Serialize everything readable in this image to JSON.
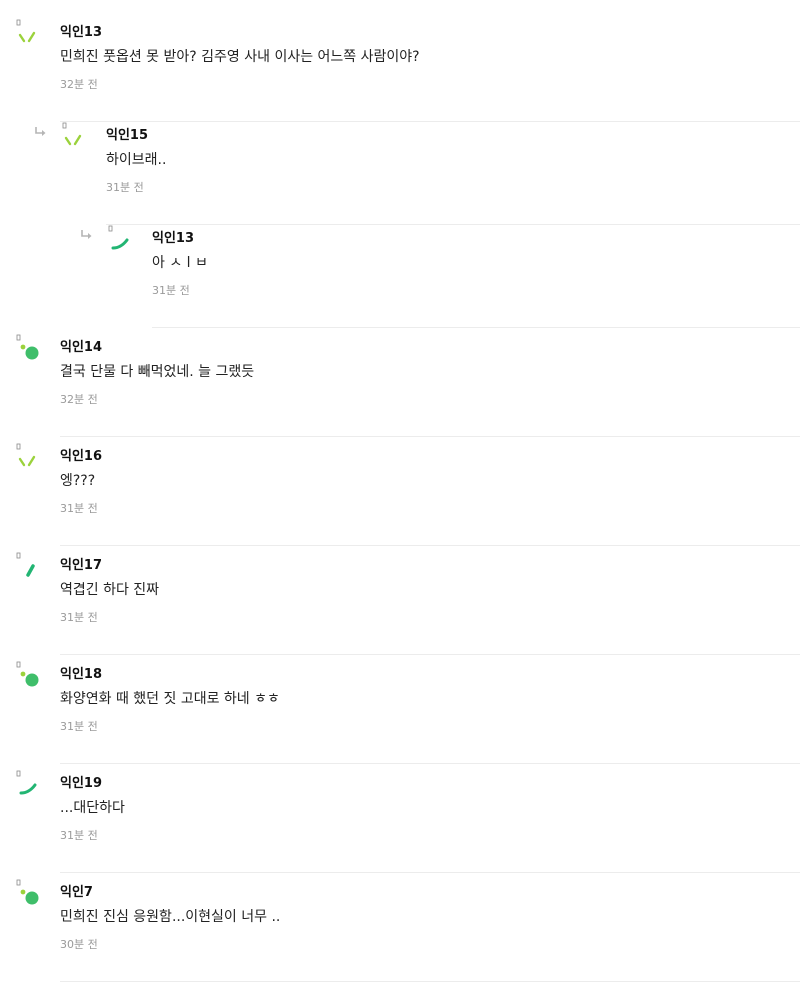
{
  "comments": [
    {
      "author": "익인13",
      "text": "민희진 풋옵션 못 받아? 김주영 사내 이사는 어느쪽 사람이야?",
      "time": "32분 전",
      "depth": 0,
      "avatar": "lime-two-strokes",
      "avatar_color": "#9bd23c"
    },
    {
      "author": "익인15",
      "text": "하이브래..",
      "time": "31분 전",
      "depth": 1,
      "avatar": "lime-two-strokes",
      "avatar_color": "#9bd23c"
    },
    {
      "author": "익인13",
      "text": "아 ㅅ l ㅂ",
      "time": "31분 전",
      "depth": 2,
      "avatar": "green-arc",
      "avatar_color": "#22b573"
    },
    {
      "author": "익인14",
      "text": "결국 단물 다 빼먹었네. 늘 그랬듯",
      "time": "32분 전",
      "depth": 0,
      "avatar": "lime-green-dots",
      "avatar_color": "#3fbe6a"
    },
    {
      "author": "익인16",
      "text": "엥???",
      "time": "31분 전",
      "depth": 0,
      "avatar": "lime-two-strokes",
      "avatar_color": "#9bd23c"
    },
    {
      "author": "익인17",
      "text": "역겹긴 하다 진짜",
      "time": "31분 전",
      "depth": 0,
      "avatar": "green-bar",
      "avatar_color": "#22b573"
    },
    {
      "author": "익인18",
      "text": "화양연화 때 했던 짓 고대로 하네 ㅎㅎ",
      "time": "31분 전",
      "depth": 0,
      "avatar": "lime-green-dots",
      "avatar_color": "#3fbe6a"
    },
    {
      "author": "익인19",
      "text": "...대단하다",
      "time": "31분 전",
      "depth": 0,
      "avatar": "green-arc",
      "avatar_color": "#22b573"
    },
    {
      "author": "익인7",
      "text": "민희진 진심 응원함...이현실이 너무 ..",
      "time": "30분 전",
      "depth": 0,
      "avatar": "lime-green-dots",
      "avatar_color": "#3fbe6a"
    }
  ]
}
